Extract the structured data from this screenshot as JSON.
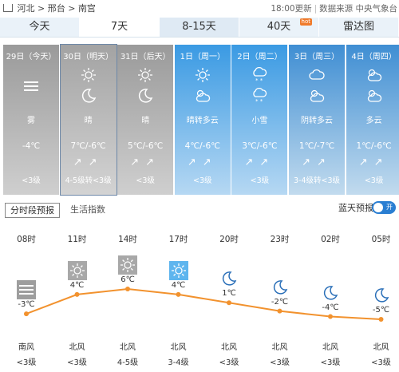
{
  "breadcrumb": {
    "province": "河北",
    "city": "邢台",
    "district": "南宫",
    "sep": ">"
  },
  "meta": {
    "updated": "18:00更新",
    "source": "数据来源 中央气象台"
  },
  "tabs": [
    {
      "label": "今天"
    },
    {
      "label": "7天"
    },
    {
      "label": "8-15天"
    },
    {
      "label": "40天",
      "badge": "hot"
    },
    {
      "label": "雷达图"
    }
  ],
  "days": [
    {
      "date": "29日（今天）",
      "icon_day": "haze-icon",
      "weather": "雾",
      "temp": "-4℃",
      "arrows": "",
      "wind": "<3级",
      "style": "past"
    },
    {
      "date": "30日（明天）",
      "icon_day": "sun-icon",
      "icon_night": "moon-icon",
      "weather": "晴",
      "temp": "7℃/-6℃",
      "arrows": "↗↗",
      "wind": "4-5级转<3级",
      "style": "today"
    },
    {
      "date": "31日（后天）",
      "icon_day": "sun-icon",
      "icon_night": "moon-icon",
      "weather": "晴",
      "temp": "5℃/-6℃",
      "arrows": "↗↗",
      "wind": "<3级",
      "style": "past"
    },
    {
      "date": "1日（周一）",
      "icon_day": "sun-icon",
      "icon_night": "partly-cloudy-icon",
      "weather": "晴转多云",
      "temp": "4℃/-6℃",
      "arrows": "↗↗",
      "wind": "<3级",
      "style": "future"
    },
    {
      "date": "2日（周二）",
      "icon_day": "snow-icon",
      "icon_night": "snow-icon",
      "weather": "小雪",
      "temp": "3℃/-6℃",
      "arrows": "↗↗",
      "wind": "<3级",
      "style": "future"
    },
    {
      "date": "3日（周三）",
      "icon_day": "cloud-icon",
      "icon_night": "partly-cloudy-icon",
      "weather": "阴转多云",
      "temp": "1℃/-7℃",
      "arrows": "↗↗",
      "wind": "3-4级转<3级",
      "style": "cloud"
    },
    {
      "date": "4日（周四）",
      "icon_day": "partly-cloudy-icon",
      "icon_night": "partly-cloudy-icon",
      "weather": "多云",
      "temp": "1℃/-6℃",
      "arrows": "↗↗",
      "wind": "<3级",
      "style": "cloud"
    }
  ],
  "subbar": {
    "hourly_label": "分时段预报",
    "life_label": "生活指数",
    "sky_label": "蓝天预报",
    "toggle_label": "开"
  },
  "chart_data": {
    "type": "line",
    "categories": [
      "08时",
      "11时",
      "14时",
      "17时",
      "20时",
      "23时",
      "02时",
      "05时"
    ],
    "values": [
      -3,
      4,
      6,
      4,
      1,
      -2,
      -4,
      -5
    ],
    "labels": [
      "-3℃",
      "4℃",
      "6℃",
      "4℃",
      "1℃",
      "-2℃",
      "-4℃",
      "-5℃"
    ],
    "icons": [
      "haze-icon",
      "sun-icon",
      "sun-icon",
      "sun-icon",
      "moon-icon",
      "moon-icon",
      "moon-icon",
      "moon-icon"
    ],
    "wind_dir": [
      "南风",
      "北风",
      "北风",
      "北风",
      "北风",
      "北风",
      "北风",
      "北风"
    ],
    "wind_level": [
      "<3级",
      "<3级",
      "4-5级",
      "3-4级",
      "<3级",
      "<3级",
      "<3级",
      "<3级"
    ],
    "line_color": "#f2922e"
  }
}
